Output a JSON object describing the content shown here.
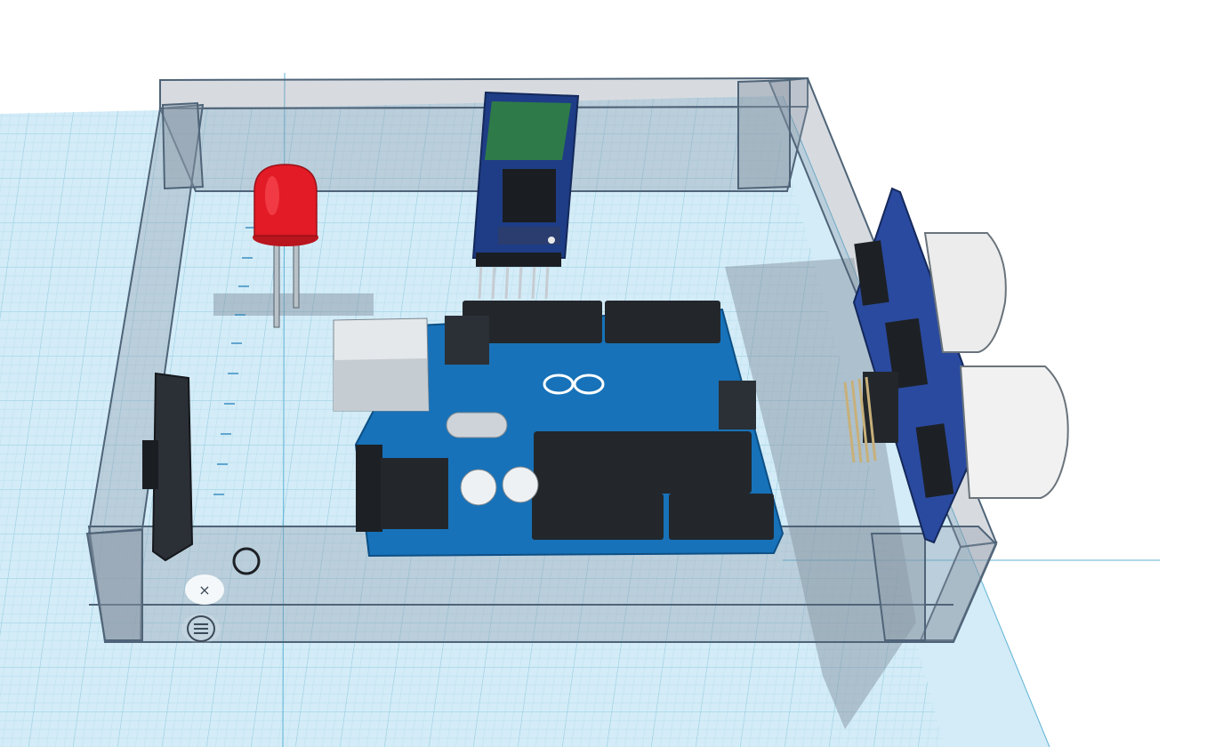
{
  "scene": {
    "grid_color": "#cfe9f5",
    "grid_line_color": "#9fd0e6",
    "box_color": "#9eaab7",
    "box_edge_color": "#4f6478"
  },
  "objects": [
    {
      "name": "enclosure-box",
      "color": "#a8b3bf"
    },
    {
      "name": "red-led",
      "color": "#e21b26"
    },
    {
      "name": "bluetooth-module",
      "color": "#1f3f8a"
    },
    {
      "name": "arduino-uno-board",
      "color": "#1772b9"
    },
    {
      "name": "ultrasonic-sensor",
      "color": "#2a4aa0"
    },
    {
      "name": "servo-horn",
      "color": "#2b2f36"
    }
  ],
  "controls": {
    "close_icon": "close-icon",
    "close_glyph": "×",
    "menu_icon": "menu-icon"
  }
}
